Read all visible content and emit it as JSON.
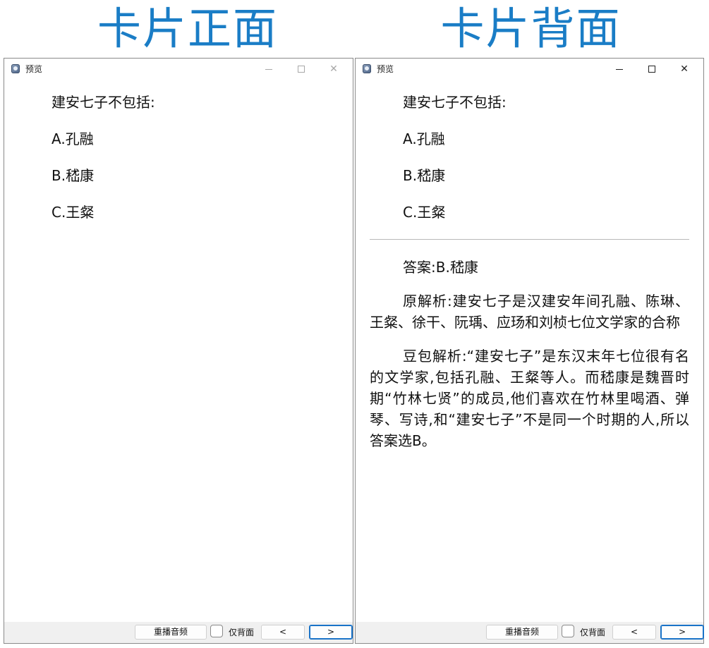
{
  "headings": {
    "front": "卡片正面",
    "back": "卡片背面"
  },
  "window": {
    "title": "预览",
    "controls": {
      "minimize": "",
      "maximize": "",
      "close": "✕"
    }
  },
  "card": {
    "question": "建安七子不包括:",
    "options": [
      "A.孔融",
      "B.嵇康",
      "C.王粲"
    ],
    "answer": "答案:B.嵇康",
    "analysis": "原解析:建安七子是汉建安年间孔融、陈琳、王粲、徐干、阮瑀、应玚和刘桢七位文学家的合称",
    "doubao_analysis": "豆包解析:“建安七子”是东汉末年七位很有名的文学家,包括孔融、王粲等人。而嵇康是魏晋时期“竹林七贤”的成员,他们喜欢在竹林里喝酒、弹琴、写诗,和“建安七子”不是同一个时期的人,所以答案选B。"
  },
  "footer": {
    "replay_label": "重播音频",
    "back_only_label": "仅背面",
    "back_only_checked": false,
    "prev_label": "<",
    "next_label": ">"
  },
  "colors": {
    "heading": "#1a7dc6",
    "focus_border": "#1a73c8"
  }
}
